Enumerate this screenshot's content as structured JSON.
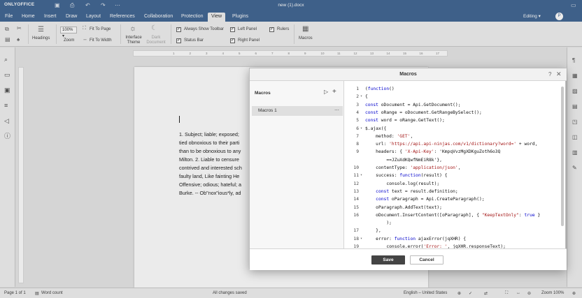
{
  "app": {
    "logo": "ONLYOFFICE",
    "doc_title": "new (1).docx",
    "editing": "Editing",
    "avatar": "P"
  },
  "tabs": [
    "File",
    "Home",
    "Insert",
    "Draw",
    "Layout",
    "References",
    "Collaboration",
    "Protection",
    "View",
    "Plugins"
  ],
  "toolbar": {
    "headings": "Headings",
    "zoom_value": "100%",
    "zoom_label": "Zoom",
    "fit_page": "Fit To Page",
    "fit_width": "Fit To Width",
    "interface_theme": "Interface Theme",
    "dark_document": "Dark Document",
    "always_show_toolbar": "Always Show Toolbar",
    "status_bar": "Status Bar",
    "left_panel": "Left Panel",
    "right_panel": "Right Panel",
    "rulers": "Rulers",
    "macros": "Macros"
  },
  "ruler_numbers": [
    "1",
    "2",
    "3",
    "4",
    "5",
    "6",
    "7",
    "8",
    "9",
    "10",
    "11",
    "12",
    "13",
    "14",
    "15",
    "16",
    "17"
  ],
  "document_lines": [
    "1. Subject; liable; exposed;",
    "tied obnoxious to their parti",
    "than to be obnoxious to any",
    "Milton. 2. Liable to censure",
    "contrived and interested sch",
    "faulty land, Like fainting He",
    "Offensive; odious; hateful; a",
    "Burke. -- Ob\"nox\"ious*ly, ad"
  ],
  "dialog": {
    "title": "Macros",
    "help": "?",
    "close": "✕",
    "panel_title": "Macros",
    "macro_item": "Macros 1",
    "save": "Save",
    "cancel": "Cancel",
    "code_lines": [
      {
        "n": "1",
        "fold": "",
        "text": "(function()"
      },
      {
        "n": "2",
        "fold": "▾",
        "text": "{"
      },
      {
        "n": "3",
        "fold": "",
        "text": "const oDocument = Api.GetDocument();"
      },
      {
        "n": "4",
        "fold": "",
        "text": "const oRange = oDocument.GetRangeBySelect();"
      },
      {
        "n": "5",
        "fold": "",
        "text": "const word = oRange.GetText();"
      },
      {
        "n": "6",
        "fold": "▾",
        "text": "$.ajax({"
      },
      {
        "n": "7",
        "fold": "",
        "text": "    method: 'GET',"
      },
      {
        "n": "8",
        "fold": "",
        "text": "    url: 'https://api.api-ninjas.com/v1/dictionary?word=' + word,"
      },
      {
        "n": "9",
        "fold": "",
        "text": "    headers: { 'X-Api-Key': 'KmpqVvzMgXDKguZoth6o3Q"
      },
      {
        "n": "",
        "fold": "",
        "text": "        ==JZuXdKQwfNmEiR8k'},"
      },
      {
        "n": "10",
        "fold": "",
        "text": "    contentType: 'application/json',"
      },
      {
        "n": "11",
        "fold": "▾",
        "text": "    success: function(result) {"
      },
      {
        "n": "12",
        "fold": "",
        "text": "        console.log(result);"
      },
      {
        "n": "13",
        "fold": "",
        "text": "    const text = result.definition;"
      },
      {
        "n": "14",
        "fold": "",
        "text": "    const oParagraph = Api.CreateParagraph();"
      },
      {
        "n": "15",
        "fold": "",
        "text": "    oParagraph.AddText(text);"
      },
      {
        "n": "16",
        "fold": "",
        "text": "    oDocument.InsertContent([oParagraph], { \"KeepTextOnly\": true }"
      },
      {
        "n": "",
        "fold": "",
        "text": "        );"
      },
      {
        "n": "17",
        "fold": "",
        "text": "    },"
      },
      {
        "n": "18",
        "fold": "▾",
        "text": "    error: function ajaxError(jqXHR) {"
      },
      {
        "n": "19",
        "fold": "",
        "text": "        console.error('Error: ', jqXHR.responseText);"
      }
    ]
  },
  "status": {
    "page": "Page 1 of 1",
    "word_count": "Word count",
    "saved": "All changes saved",
    "language": "English – United States",
    "zoom": "Zoom 100%"
  },
  "colors": {
    "header": "#446995",
    "save_button": "#444444"
  }
}
